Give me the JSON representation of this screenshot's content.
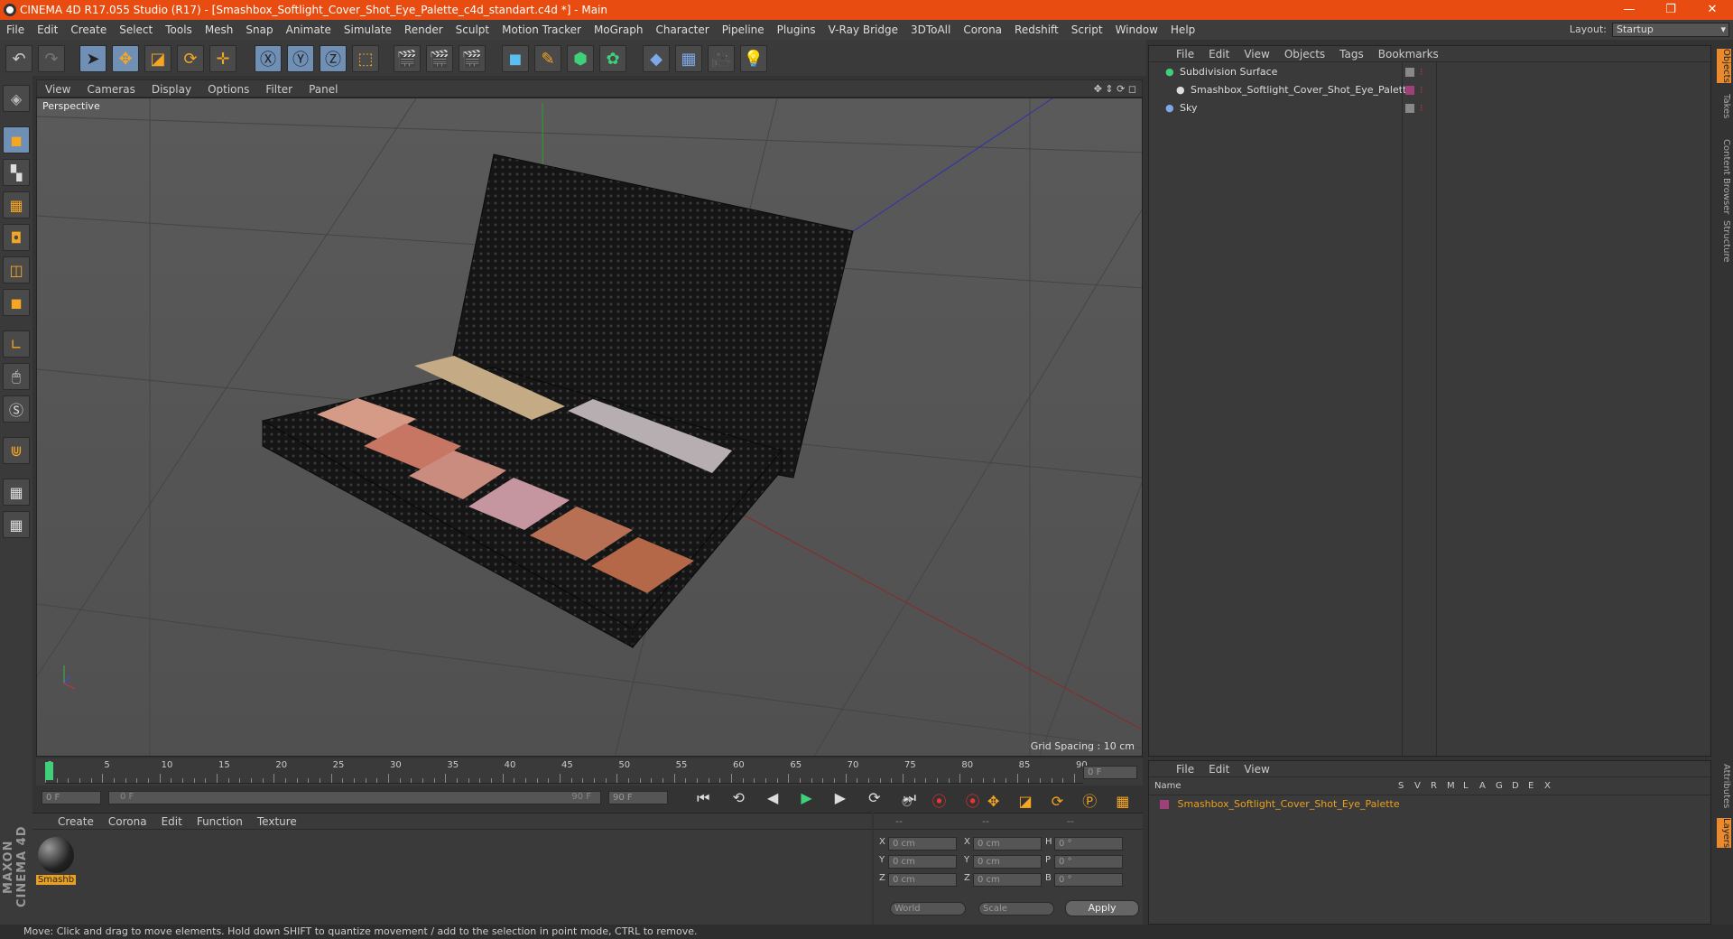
{
  "window": {
    "title": "CINEMA 4D R17.055 Studio (R17) - [Smashbox_Softlight_Cover_Shot_Eye_Palette_c4d_standart.c4d *] - Main",
    "minimize": "—",
    "restore": "❐",
    "close": "✕"
  },
  "menu": {
    "items": [
      "File",
      "Edit",
      "Create",
      "Select",
      "Tools",
      "Mesh",
      "Snap",
      "Animate",
      "Simulate",
      "Render",
      "Sculpt",
      "Motion Tracker",
      "MoGraph",
      "Character",
      "Pipeline",
      "Plugins",
      "V-Ray Bridge",
      "3DToAll",
      "Corona",
      "Redshift",
      "Script",
      "Window",
      "Help"
    ],
    "layout_label": "Layout:",
    "layout_value": "Startup"
  },
  "viewport": {
    "menu": [
      "View",
      "Cameras",
      "Display",
      "Options",
      "Filter",
      "Panel"
    ],
    "label": "Perspective",
    "grid_spacing": "Grid Spacing : 10 cm"
  },
  "timeline": {
    "ticks": [
      "0",
      "5",
      "10",
      "15",
      "20",
      "25",
      "30",
      "35",
      "40",
      "45",
      "50",
      "55",
      "60",
      "65",
      "70",
      "75",
      "80",
      "85",
      "90"
    ],
    "current_frame": "0 F",
    "start_field": "0 F",
    "range_start": "0 F",
    "range_end": "90 F",
    "end_field": "90 F"
  },
  "material_manager": {
    "menu": [
      "Create",
      "Corona",
      "Edit",
      "Function",
      "Texture"
    ],
    "material_name": "Smashb"
  },
  "attributes": {
    "header": [
      "--",
      "--",
      "--"
    ],
    "rows": [
      {
        "a": "X",
        "av": "0 cm",
        "b": "X",
        "bv": "0 cm",
        "c": "H",
        "cv": "0 °"
      },
      {
        "a": "Y",
        "av": "0 cm",
        "b": "Y",
        "bv": "0 cm",
        "c": "P",
        "cv": "0 °"
      },
      {
        "a": "Z",
        "av": "0 cm",
        "b": "Z",
        "bv": "0 cm",
        "c": "B",
        "cv": "0 °"
      }
    ],
    "coord_mode": "World",
    "size_mode": "Scale",
    "apply": "Apply"
  },
  "object_manager": {
    "menu": [
      "File",
      "Edit",
      "View",
      "Objects",
      "Tags",
      "Bookmarks"
    ],
    "objects": [
      {
        "name": "Subdivision Surface",
        "indent": 0
      },
      {
        "name": "Smashbox_Softlight_Cover_Shot_Eye_Palette",
        "indent": 1
      },
      {
        "name": "Sky",
        "indent": 0
      }
    ]
  },
  "layer_manager": {
    "menu": [
      "File",
      "Edit",
      "View"
    ],
    "columns": [
      "Name",
      "S",
      "V",
      "R",
      "M",
      "L",
      "A",
      "G",
      "D",
      "E",
      "X"
    ],
    "layer_name": "Smashbox_Softlight_Cover_Shot_Eye_Palette"
  },
  "side_tabs": [
    "Objects",
    "Takes",
    "Content Browser",
    "Structure"
  ],
  "side_tabs_bottom": [
    "Attributes",
    "Layers"
  ],
  "status": "Move: Click and drag to move elements. Hold down SHIFT to quantize movement / add to the selection in point mode, CTRL to remove."
}
